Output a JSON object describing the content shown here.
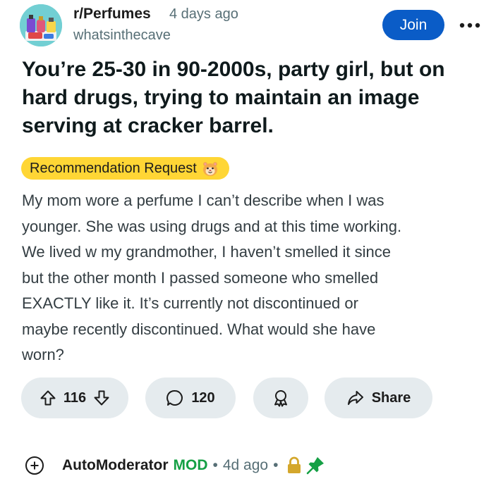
{
  "header": {
    "subreddit": "r/Perfumes",
    "post_age": "4 days ago",
    "author": "whatsinthecave",
    "join_label": "Join",
    "more_icon": "ellipsis-icon"
  },
  "post": {
    "title": "You’re 25-30 in 90-2000s, party girl, but on hard drugs, trying to maintain an image serving at cracker barrel.",
    "flair": {
      "label": "Recommendation Request",
      "color": "#ffd635",
      "emoji_icon": "hamster-emoji-icon"
    },
    "body_lines": [
      "My mom wore a perfume I can’t describe when I was",
      "younger. She was using drugs and at this time working.",
      "We lived w my grandmother, I haven’t smelled it since",
      "but the other month I passed someone who smelled",
      "EXACTLY like it. It’s currently not discontinued or",
      "maybe recently discontinued. What would she have",
      "worn?"
    ]
  },
  "actions": {
    "upvote_count": "116",
    "comment_count": "120",
    "share_label": "Share",
    "pill_color": "#e5ebee"
  },
  "comment": {
    "author": "AutoModerator",
    "badge": "MOD",
    "separator": "•",
    "age": "4d ago",
    "badge_color": "#15a045",
    "lock_color": "#d4a72c",
    "pin_color": "#15a045"
  },
  "colors": {
    "join_button": "#0a5cc7",
    "secondary_text": "#576f76"
  }
}
